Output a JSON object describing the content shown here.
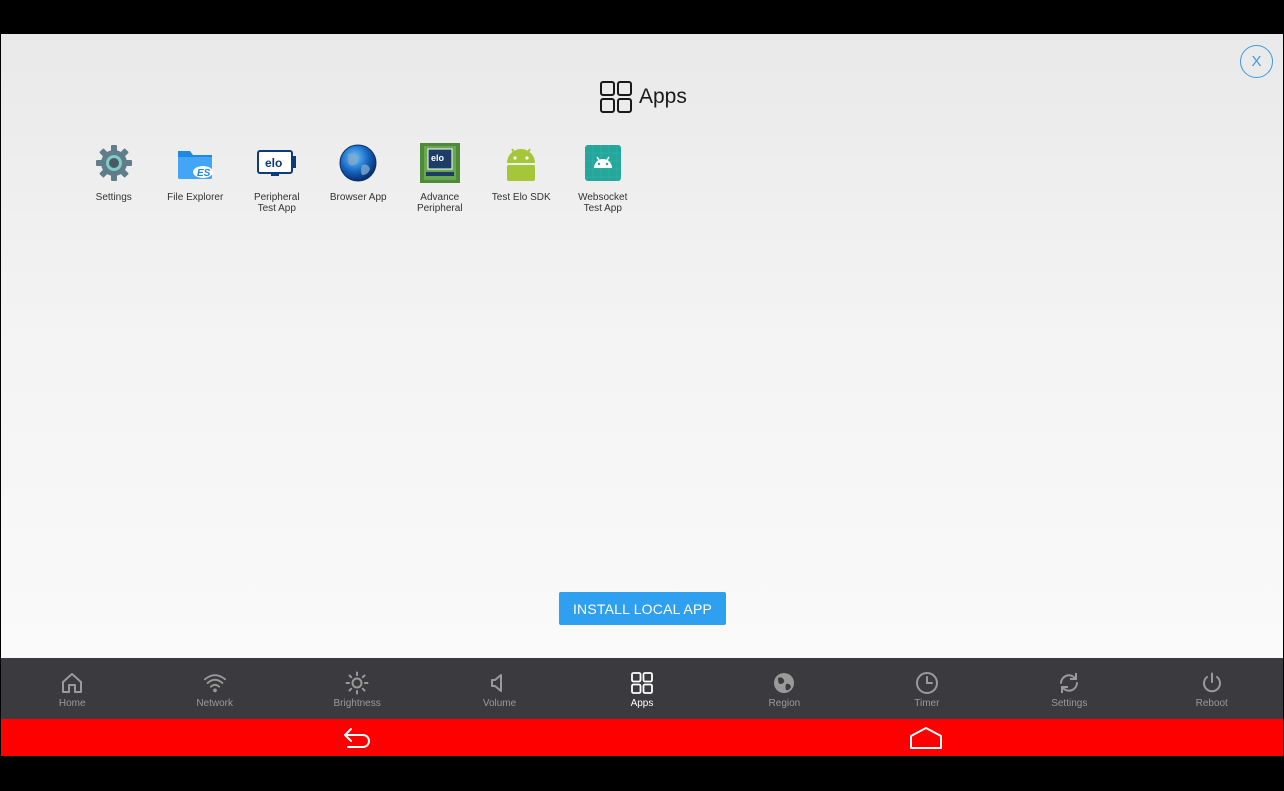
{
  "header": {
    "title": "Apps",
    "title_icon": "grid-icon",
    "close_label": "X"
  },
  "apps": [
    {
      "label": "Settings",
      "icon": "gear-icon"
    },
    {
      "label": "File Explorer",
      "icon": "folder-icon"
    },
    {
      "label": "Peripheral\nTest App",
      "icon": "elo-monitor-icon"
    },
    {
      "label": "Browser App",
      "icon": "globe-icon"
    },
    {
      "label": "Advance\nPeripheral",
      "icon": "elo-display-icon"
    },
    {
      "label": "Test Elo SDK",
      "icon": "android-icon"
    },
    {
      "label": "Websocket\nTest App",
      "icon": "android-tile-icon"
    }
  ],
  "install_button": {
    "label": "INSTALL LOCAL APP"
  },
  "nav": {
    "active": "Apps",
    "items": [
      {
        "label": "Home",
        "icon": "home-icon"
      },
      {
        "label": "Network",
        "icon": "wifi-icon"
      },
      {
        "label": "Brightness",
        "icon": "sun-icon"
      },
      {
        "label": "Volume",
        "icon": "speaker-icon"
      },
      {
        "label": "Apps",
        "icon": "grid-icon"
      },
      {
        "label": "Region",
        "icon": "globe-icon"
      },
      {
        "label": "Timer",
        "icon": "clock-icon"
      },
      {
        "label": "Settings",
        "icon": "refresh-icon"
      },
      {
        "label": "Reboot",
        "icon": "power-icon"
      }
    ]
  },
  "colors": {
    "accent": "#2f9ff0",
    "navbar": "#3b3b3f",
    "system_bar": "#ff0000"
  }
}
